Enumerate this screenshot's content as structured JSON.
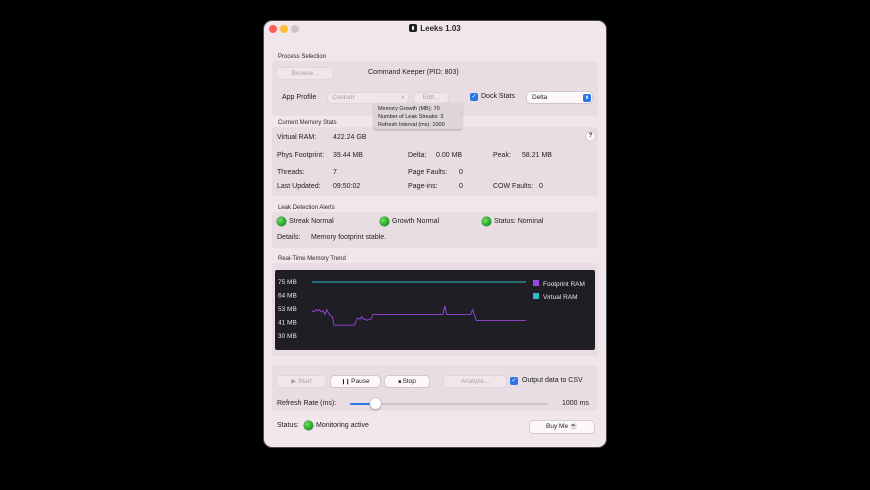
{
  "window": {
    "title": "Leeks 1.03"
  },
  "process_selection": {
    "section_label": "Process Selection",
    "browse_label": "Browse...",
    "process_name": "Command Keeper (PID: 803)",
    "app_profile_label": "App Profile",
    "app_profile_value": "Custom",
    "edit_label": "Edit...",
    "dock_stats_label": "Dock Stats",
    "dock_stats_checked": true,
    "dock_mode_value": "Delta"
  },
  "tooltip": {
    "lines": [
      "Memory Growth (MB): 70",
      "Number of Leak Streaks: 3",
      "Refresh Interval (ms): 1000"
    ]
  },
  "memory_stats": {
    "section_label": "Current Memory Stats",
    "help_label": "?",
    "virtual_ram_label": "Virtual RAM:",
    "virtual_ram_value": "422.24 GB",
    "phys_footprint_label": "Phys Footprint:",
    "phys_footprint_value": "39.44 MB",
    "delta_label": "Delta:",
    "delta_value": "0.00 MB",
    "peak_label": "Peak:",
    "peak_value": "58.21 MB",
    "threads_label": "Threads:",
    "threads_value": "7",
    "page_faults_label": "Page Faults:",
    "page_faults_value": "0",
    "last_updated_label": "Last Updated:",
    "last_updated_value": "09:50:02",
    "page_ins_label": "Page-ins:",
    "page_ins_value": "0",
    "cow_faults_label": "COW Faults:",
    "cow_faults_value": "0"
  },
  "leak_alerts": {
    "section_label": "Leak Detection Alerts",
    "streak_label": "Streak Normal",
    "growth_label": "Growth Normal",
    "status_label": "Status: Nominal",
    "details_label": "Details:",
    "details_value": "Memory footprint stable."
  },
  "trend": {
    "section_label": "Real-Time Memory Trend"
  },
  "chart_data": {
    "type": "line",
    "title": "",
    "ytick_labels": [
      "75 MB",
      "64 MB",
      "53 MB",
      "41 MB",
      "30 MB"
    ],
    "ylim": [
      30,
      75
    ],
    "legend_position": "right",
    "series": [
      {
        "name": "Footprint RAM",
        "color": "#9b45e0",
        "values": [
          51,
          50,
          52,
          51,
          52,
          50,
          51,
          48,
          52,
          49,
          47,
          46,
          39,
          39,
          39,
          39,
          39,
          39,
          39,
          39,
          39,
          39,
          39,
          39,
          43,
          45,
          44,
          46,
          44,
          44,
          43,
          44,
          44,
          48,
          48,
          48,
          48,
          48,
          48,
          48,
          48,
          48,
          48,
          48,
          48,
          48,
          48,
          48,
          48,
          48,
          48,
          48,
          48,
          48,
          48,
          48,
          48,
          48,
          48,
          48,
          48,
          48,
          48,
          48,
          48,
          48,
          48,
          48,
          48,
          48,
          48,
          48,
          55,
          48,
          48,
          48,
          48,
          48,
          48,
          48,
          48,
          48,
          48,
          48,
          48,
          48,
          48,
          52,
          48,
          43,
          43,
          43,
          43,
          43,
          43,
          43,
          43,
          43,
          43,
          43,
          43,
          43,
          43,
          43,
          43,
          43,
          43,
          43,
          43,
          43,
          43,
          43,
          43,
          43,
          43,
          43,
          43
        ]
      },
      {
        "name": "Virtual RAM",
        "color": "#2fb9c9",
        "values": [
          75,
          75,
          75,
          75,
          75,
          75,
          75,
          75,
          75,
          75,
          75,
          75,
          75,
          75,
          75,
          75,
          75,
          75,
          75,
          75,
          75,
          75,
          75,
          75,
          75,
          75,
          75,
          75,
          75,
          75,
          75,
          75,
          75,
          75,
          75,
          75,
          75,
          75,
          75,
          75,
          75,
          75,
          75,
          75,
          75,
          75,
          75,
          75,
          75,
          75,
          75,
          75,
          75,
          75,
          75,
          75,
          75,
          75,
          75,
          75,
          75,
          75,
          75,
          75,
          75,
          75,
          75,
          75,
          75,
          75,
          75,
          75,
          75,
          75,
          75,
          75,
          75,
          75,
          75,
          75,
          75,
          75,
          75,
          75,
          75,
          75,
          75,
          75,
          75,
          75,
          75,
          75,
          75,
          75,
          75,
          75,
          75,
          75,
          75,
          75,
          75,
          75,
          75,
          75,
          75,
          75,
          75,
          75,
          75,
          75,
          75,
          75,
          75,
          75,
          75
        ]
      }
    ]
  },
  "controls": {
    "start_label": "▶ Start",
    "pause_label": "Pause",
    "stop_label": "Stop",
    "analyze_label": "Analyze...",
    "csv_label": "Output data to CSV",
    "csv_checked": true,
    "refresh_label": "Refresh Rate (ms):",
    "refresh_value": "1000 ms",
    "refresh_level_fraction": 0.13
  },
  "footer": {
    "status_label": "Status:",
    "status_value": "Monitoring active",
    "buy_label": "Buy Me ☕"
  },
  "colors": {
    "accent": "#2b76e6",
    "status_green": "#22b02a",
    "window_bg": "#f0e6ec",
    "chart_bg": "#1e1e24"
  }
}
